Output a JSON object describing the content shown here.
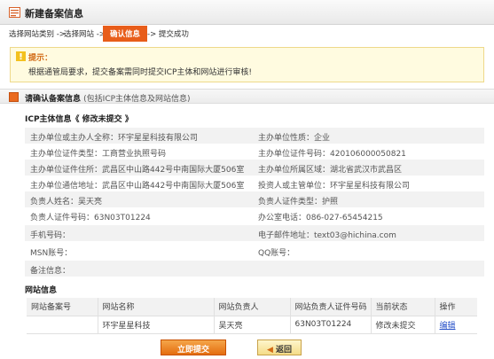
{
  "header": {
    "title": "新建备案信息"
  },
  "steps": {
    "step1": "选择网站类别 ->",
    "step2": "选择网站 ->",
    "active": "确认信息",
    "step4": "-> 提交成功"
  },
  "tip": {
    "heading": "提示：",
    "body": "根据通管局要求，提交备案需同时提交ICP主体和网站进行审核!"
  },
  "section": {
    "title": "请确认备案信息",
    "subtitle": "(包括ICP主体信息及网站信息)"
  },
  "icp": {
    "heading": "ICP主体信息《 修改未提交 》",
    "rows": [
      {
        "left": "主办单位或主办人全称：环宇星星科技有限公司",
        "right": "主办单位性质：企业"
      },
      {
        "left": "主办单位证件类型：工商营业执照号码",
        "right": "主办单位证件号码：420106000050821"
      },
      {
        "left": "主办单位证件住所：武昌区中山路442号中南国际大厦506室",
        "right": "主办单位所属区域：湖北省武汉市武昌区"
      },
      {
        "left": "主办单位通信地址：武昌区中山路442号中南国际大厦506室",
        "right": "投资人或主管单位：环宇星星科技有限公司"
      },
      {
        "left": "负责人姓名：吴天亮",
        "right": "负责人证件类型：护照"
      },
      {
        "left": "负责人证件号码：63N03T01224",
        "right": "办公室电话：086-027-65454215"
      },
      {
        "left": "手机号码：",
        "right": "电子邮件地址：text03@hichina.com"
      },
      {
        "left": "MSN账号：",
        "right": "QQ账号："
      },
      {
        "left": "备注信息：",
        "right": ""
      }
    ]
  },
  "website": {
    "heading": "网站信息",
    "columns": [
      "网站备案号",
      "网站名称",
      "网站负责人",
      "网站负责人证件号码",
      "当前状态",
      "操作"
    ],
    "rows": [
      {
        "c1": "",
        "c2": "环宇星星科技",
        "c3": "吴天亮",
        "c4": "63N03T01224",
        "c5": "修改未提交",
        "c6": "编辑"
      }
    ]
  },
  "buttons": {
    "submit": "立即提交",
    "back": "返回"
  },
  "colors": {
    "accent": "#e85d1a",
    "tip_bg": "#fffbe0",
    "link": "#2a53c9"
  }
}
